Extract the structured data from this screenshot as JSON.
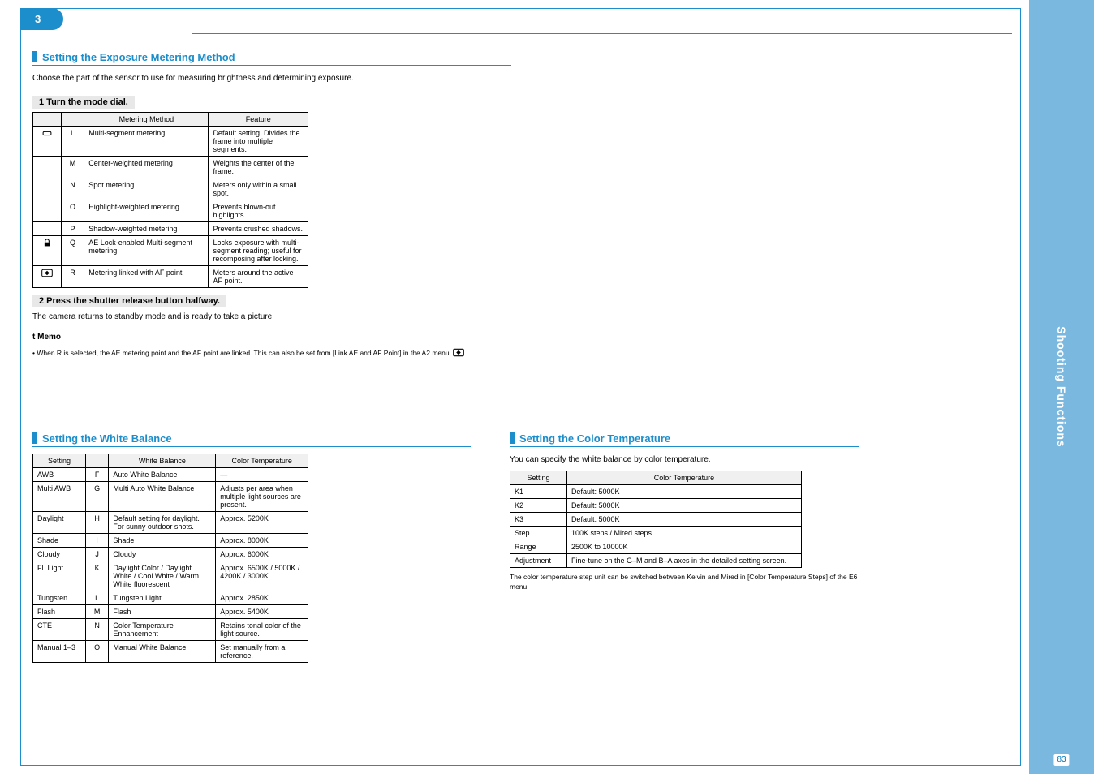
{
  "sidebar": {
    "label": "Shooting Functions",
    "page_number": "83"
  },
  "chapter": "3",
  "section1": {
    "title": "Setting the Exposure Metering Method",
    "intro": "Choose the part of the sensor to use for measuring brightness and determining exposure.",
    "sub_a": "1 Turn the mode dial.",
    "table1": {
      "headers": [
        "",
        "",
        "Metering Method",
        "Feature"
      ],
      "rows": [
        {
          "icon": "multi",
          "label": "L",
          "method": "Multi-segment metering",
          "feature": "Default setting. Divides the frame into multiple segments."
        },
        {
          "icon": "",
          "label": "M",
          "method": "Center-weighted metering",
          "feature": "Weights the center of the frame."
        },
        {
          "icon": "",
          "label": "N",
          "method": "Spot metering",
          "feature": "Meters only within a small spot."
        },
        {
          "icon": "",
          "label": "O",
          "method": "Highlight-weighted metering",
          "feature": "Prevents blown-out highlights."
        },
        {
          "icon": "",
          "label": "P",
          "method": "Shadow-weighted metering",
          "feature": "Prevents crushed shadows."
        },
        {
          "icon": "lock",
          "label": "Q",
          "method": "AE Lock-enabled Multi-segment metering",
          "feature": "Locks exposure with multi-segment reading; useful for recomposing after locking."
        },
        {
          "icon": "link",
          "label": "R",
          "method": "Metering linked with AF point",
          "feature": "Meters around the active AF point."
        }
      ]
    },
    "sub_b": "2 Press the shutter release button halfway.",
    "note_b": "The camera returns to standby mode and is ready to take a picture.",
    "memo_title": "t Memo",
    "memo_body": "• When R is selected, the AE metering point and the AF point are linked. This can also be set from [Link AE and AF Point] in the A2 menu.",
    "memo_link": "R"
  },
  "section2": {
    "title": "Setting the White Balance",
    "table": {
      "headers": [
        "Setting",
        "",
        "White Balance",
        "Color Temperature"
      ],
      "rows": [
        {
          "setting": "AWB",
          "k": "F",
          "wb": "Auto White Balance",
          "ct": "—"
        },
        {
          "setting": "Multi AWB",
          "k": "G",
          "wb": "Multi Auto White Balance",
          "ct": "Adjusts per area when multiple light sources are present."
        },
        {
          "setting": "Daylight",
          "k": "H",
          "wb": "Default setting for daylight. For sunny outdoor shots.",
          "ct": "Approx. 5200K"
        },
        {
          "setting": "Shade",
          "k": "I",
          "wb": "Shade",
          "ct": "Approx. 8000K"
        },
        {
          "setting": "Cloudy",
          "k": "J",
          "wb": "Cloudy",
          "ct": "Approx. 6000K"
        },
        {
          "setting": "Fl. Light",
          "k": "K",
          "wb": "Daylight Color / Daylight White / Cool White / Warm White fluorescent",
          "ct": "Approx. 6500K / 5000K / 4200K / 3000K"
        },
        {
          "setting": "Tungsten",
          "k": "L",
          "wb": "Tungsten Light",
          "ct": "Approx. 2850K"
        },
        {
          "setting": "Flash",
          "k": "M",
          "wb": "Flash",
          "ct": "Approx. 5400K"
        },
        {
          "setting": "CTE",
          "k": "N",
          "wb": "Color Temperature Enhancement",
          "ct": "Retains tonal color of the light source."
        },
        {
          "setting": "Manual 1–3",
          "k": "O",
          "wb": "Manual White Balance",
          "ct": "Set manually from a reference."
        }
      ]
    }
  },
  "section3": {
    "title": "Setting the Color Temperature",
    "intro": "You can specify the white balance by color temperature.",
    "table": {
      "headers": [
        "Setting",
        "Color Temperature"
      ],
      "rows": [
        {
          "setting": "K1",
          "ct": "Default: 5000K"
        },
        {
          "setting": "K2",
          "ct": "Default: 5000K"
        },
        {
          "setting": "K3",
          "ct": "Default: 5000K"
        },
        {
          "setting": "Step",
          "ct": "100K steps / Mired steps"
        },
        {
          "setting": "Range",
          "ct": "2500K to 10000K"
        },
        {
          "setting": "Adjustment",
          "ct": "Fine-tune on the G–M and B–A axes in the detailed setting screen."
        }
      ]
    },
    "note": "The color temperature step unit can be switched between Kelvin and Mired in [Color Temperature Steps] of the E6 menu."
  }
}
